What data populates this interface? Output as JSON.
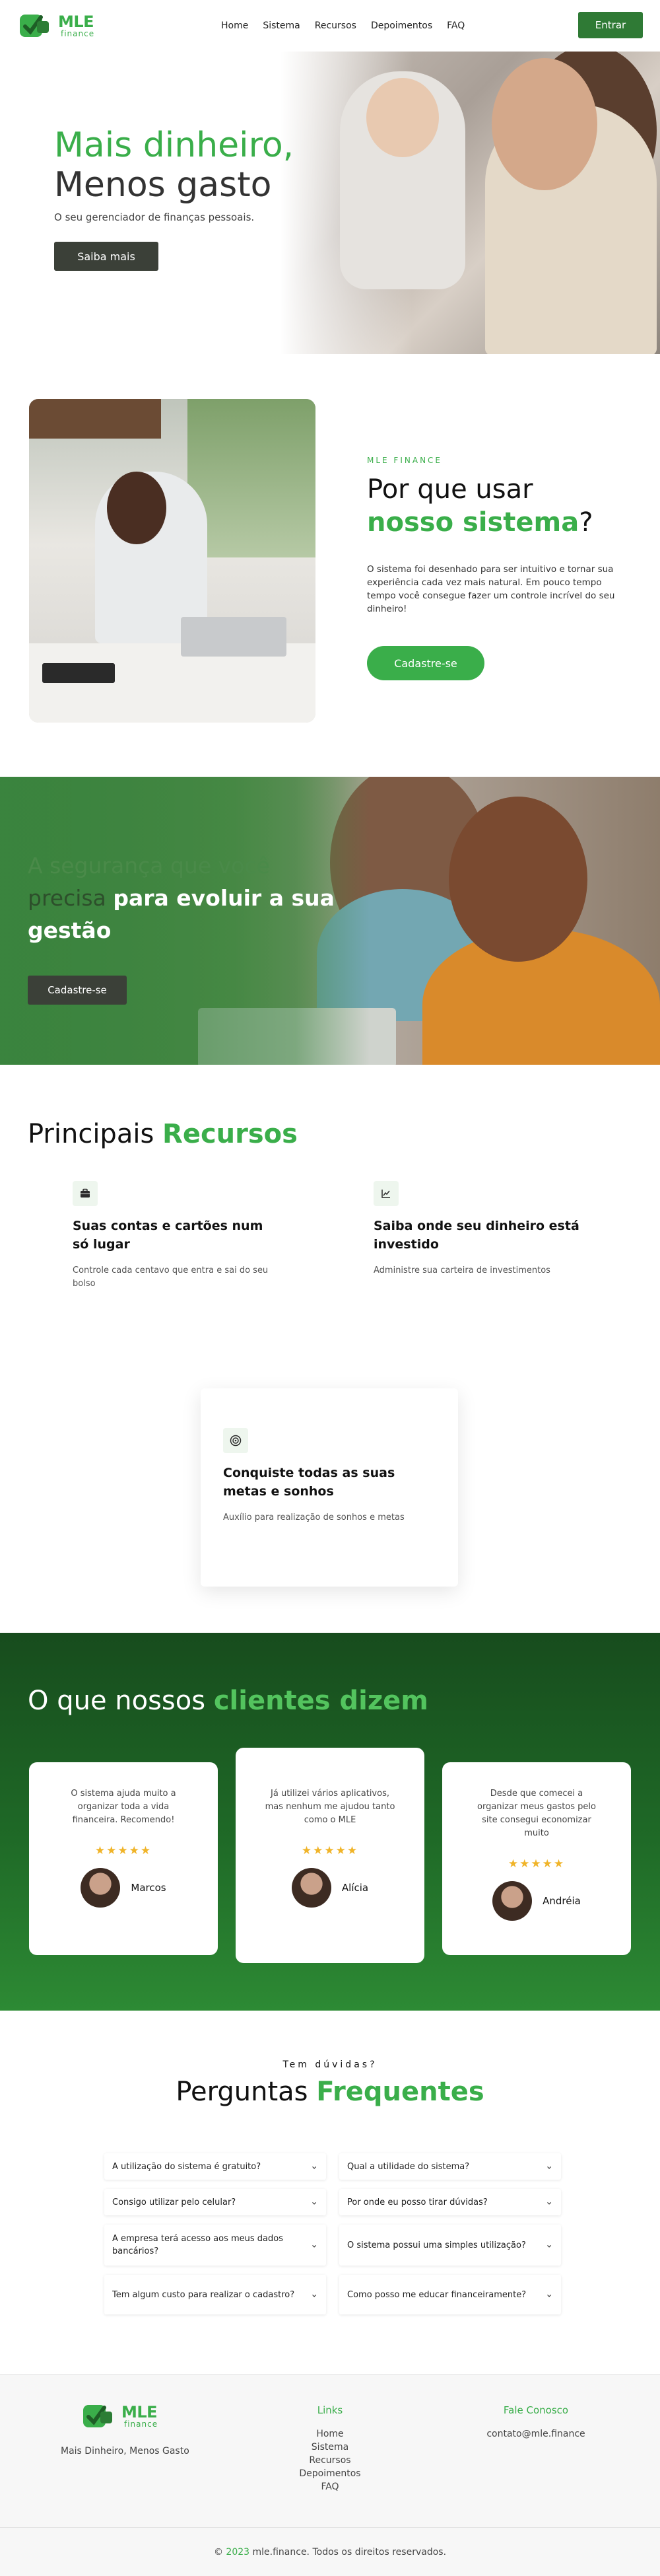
{
  "header": {
    "logo_title": "MLE",
    "logo_sub": "finance",
    "nav": [
      "Home",
      "Sistema",
      "Recursos",
      "Depoimentos",
      "FAQ"
    ],
    "enter_label": "Entrar"
  },
  "hero": {
    "title_line1": "Mais dinheiro,",
    "title_line2": "Menos gasto",
    "subtitle": "O seu gerenciador de finanças pessoais.",
    "button": "Saiba mais"
  },
  "why": {
    "eyebrow": "MLE FINANCE",
    "title_part1": "Por que usar",
    "title_green": "nosso sistema",
    "title_end": "?",
    "description": "O sistema foi desenhado para ser intuitivo e tornar sua experiência cada vez mais natural. Em pouco tempo tempo você consegue fazer um controle incrível do seu dinheiro!",
    "button": "Cadastre-se"
  },
  "security": {
    "text_light": "A segurança que você",
    "text_dark": "precisa",
    "text_bold": "para evoluir a sua gestão",
    "button": "Cadastre-se"
  },
  "features": {
    "title_part1": "Principais",
    "title_green": "Recursos",
    "items": [
      {
        "icon": "briefcase-icon",
        "title": "Suas contas e cartões num só lugar",
        "desc": "Controle cada centavo que entra e sai do seu bolso"
      },
      {
        "icon": "chart-icon",
        "title": "Saiba onde seu dinheiro está investido",
        "desc": "Administre sua carteira de investimentos"
      },
      {
        "icon": "target-icon",
        "title": "Conquiste todas as suas metas e sonhos",
        "desc": "Auxílio para realização de sonhos e metas"
      }
    ]
  },
  "testimonials": {
    "title_part1": "O que nossos",
    "title_green": "clientes dizem",
    "items": [
      {
        "quote": "O sistema ajuda muito a organizar toda a vida financeira. Recomendo!",
        "stars": "★★★★★",
        "name": "Marcos"
      },
      {
        "quote": "Já utilizei vários aplicativos, mas nenhum me ajudou tanto como o MLE",
        "stars": "★★★★★",
        "name": "Alícia"
      },
      {
        "quote": "Desde que comecei a organizar meus gastos pelo site consegui economizar muito",
        "stars": "★★★★★",
        "name": "Andréia"
      }
    ]
  },
  "faq": {
    "eyebrow": "Tem dúvidas?",
    "title_part1": "Perguntas",
    "title_green": "Frequentes",
    "items": [
      "A utilização do sistema é gratuito?",
      "Qual a utilidade do sistema?",
      "Consigo utilizar pelo celular?",
      "Por onde eu posso tirar dúvidas?",
      "A empresa terá acesso aos meus dados bancários?",
      "O sistema possui uma simples utilização?",
      "Tem algum custo para realizar o cadastro?",
      "Como posso me educar financeiramente?"
    ]
  },
  "footer": {
    "tagline": "Mais Dinheiro, Menos Gasto",
    "links_title": "Links",
    "links": [
      "Home",
      "Sistema",
      "Recursos",
      "Depoimentos",
      "FAQ"
    ],
    "contact_title": "Fale Conosco",
    "contact_email": "contato@mle.finance",
    "copyright_symbol": "©",
    "copyright_year": "2023",
    "copyright_text": "mle.finance. Todos os direitos reservados."
  },
  "colors": {
    "accent": "#3aae4a",
    "dark_green": "#1f6a27",
    "button_dark": "#3b4038"
  }
}
